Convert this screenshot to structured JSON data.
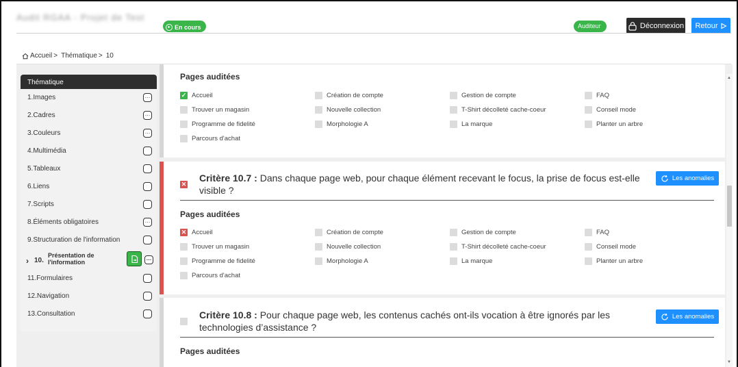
{
  "header": {
    "app_title": "Audit  RGAA  -  Projet de  Test",
    "status": "En cours",
    "role": "Auditeur",
    "logout_label": "Déconnexion",
    "back_label": "Retour"
  },
  "breadcrumb": {
    "home": "Accueil",
    "sep1": ">",
    "theme": "Thématique",
    "sep2": ">",
    "current": "10"
  },
  "sidebar": {
    "title": "Thématique",
    "items": [
      {
        "label": "1.Images",
        "mark": "…"
      },
      {
        "label": "2.Cadres",
        "mark": "…"
      },
      {
        "label": "3.Couleurs",
        "mark": "…"
      },
      {
        "label": "4.Multimédia",
        "mark": ""
      },
      {
        "label": "5.Tableaux",
        "mark": ""
      },
      {
        "label": "6.Liens",
        "mark": ""
      },
      {
        "label": "7.Scripts",
        "mark": ""
      },
      {
        "label": "8.Éléments obligatoires",
        "mark": "…"
      },
      {
        "label": "9.Structuration de l'information",
        "mark": ""
      },
      {
        "num": "10.",
        "label_line1": "Présentation de",
        "label_line2": "l'information",
        "mark": "…"
      },
      {
        "label": "11.Formulaires",
        "mark": ""
      },
      {
        "label": "12.Navigation",
        "mark": ""
      },
      {
        "label": "13.Consultation",
        "mark": ""
      }
    ]
  },
  "pages_label": "Pages auditées",
  "pages": [
    "Accueil",
    "Création de compte",
    "Gestion de compte",
    "FAQ",
    "Trouver un magasin",
    "Nouvelle collection",
    "T-Shirt décolleté cache-coeur",
    "Conseil mode",
    "Programme de fidelité",
    "Morphologie A",
    "La marque",
    "Planter un arbre",
    "Parcours d'achat"
  ],
  "criteria": [
    {
      "id": "Critère 10.7 :",
      "text": " Dans chaque page web, pour chaque élément recevant le focus, la prise de focus est-elle visible ?",
      "status": "non-conforme",
      "button": "Les anomalies"
    },
    {
      "id": "Critère 10.8 :",
      "text": " Pour chaque page web, les contenus cachés ont-ils vocation à être ignorés par les technologies d’assistance ?",
      "status": "non-applicable",
      "button": "Les anomalies"
    }
  ],
  "colors": {
    "green": "#39b54a",
    "red": "#d9534f",
    "blue": "#1e90ff",
    "dark": "#2b2b2b"
  }
}
